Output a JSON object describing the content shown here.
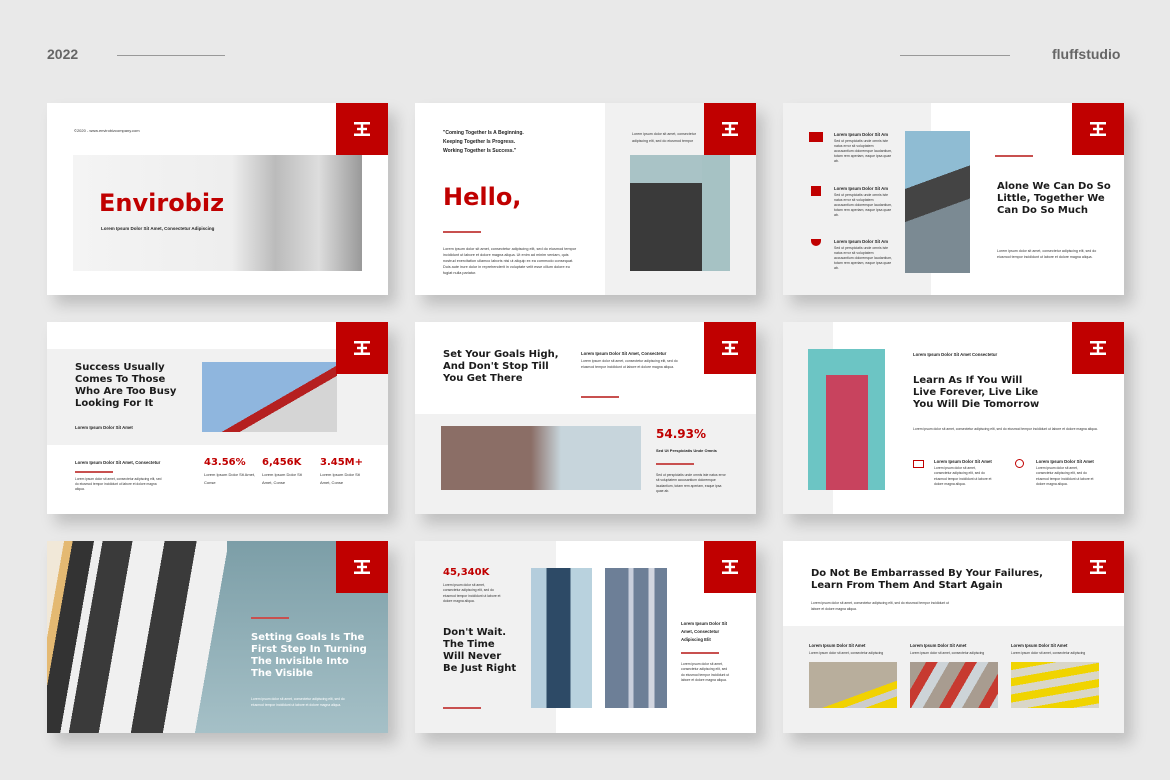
{
  "header": {
    "year": "2022",
    "brand": "fluffstudio"
  },
  "colors": {
    "accent": "#c00000",
    "panel": "#f1f1f1",
    "background": "#e9e9e9"
  },
  "logo_icon": "envirobiz-logo-icon",
  "lorem_short": "Lorem ipsum dolor sit amet, consectetur adipiscing elit, sed do eiusmod tempor incididunt ut labore et dolore magna aliqua.",
  "lorem_long": "Lorem ipsum dolor sit amet, consectetur adipiscing elit, sed do eiusmod tempor incididunt ut labore et dolore magna aliqua. Ut enim ad minim veniam, quis nostrud exercitation ullamco laboris nisi ut aliquip ex ea commodo consequat. Duis aute irure dolor in reprehenderit in voluptate velit esse cillum dolore eu fugiat nulla pariatur.",
  "lorem_sed": "Sed ut perspiciatis unde omnis iste natus error sit voluptatem accusantium doloremque laudantium, totam rem aperiam, eaque ipsa quae ab.",
  "slides": [
    {
      "copyright": "©2020 - www.envirobizcompany.com",
      "title": "Envirobiz",
      "subtitle": "Lorem Ipsum Dolor Sit Amet, Consectetur Adipiscing"
    },
    {
      "quote": [
        "\"Coming Together Is A Beginning.",
        "Keeping Together Is Progress.",
        "Working Together Is Success.\""
      ],
      "title": "Hello,",
      "side_text": "Lorem ipsum dolor sit amet, consectetur adipiscing elit, sed do eiusmod tempor"
    },
    {
      "items": [
        {
          "icon": "building-icon",
          "title": "Lorem Ipsum Dolor Sit Am"
        },
        {
          "icon": "calendar-icon",
          "title": "Lorem Ipsum Dolor Sit Am"
        },
        {
          "icon": "trophy-icon",
          "title": "Lorem Ipsum Dolor Sit Am"
        }
      ],
      "title": "Alone We Can Do So Little, Together We Can Do So Much"
    },
    {
      "title": "Success Usually Comes To Those Who Are Too Busy Looking For It",
      "subtitle": "Lorem Ipsum Dolor Sit Amet",
      "left_title": "Lorem Ipsum Dolor Sit Amet, Consectetur",
      "stats": [
        {
          "value": "43.56%",
          "label": "Lorem Ipsum Dolor Sit Amet, Conse"
        },
        {
          "value": "6,456K",
          "label": "Lorem Ipsum Dolor Sit Amet, Conse"
        },
        {
          "value": "3.45M+",
          "label": "Lorem Ipsum Dolor Sit Amet, Conse"
        }
      ]
    },
    {
      "title": "Set Your Goals High, And Don't Stop Till You Get There",
      "side_title": "Lorem Ipsum Dolor Sit Amet, Consectetur",
      "stat": "54.93%",
      "stat_label": "Sed Ut Perspiciatis Unde Omnis"
    },
    {
      "kicker": "Lorem Ipsum Dolor Sit Amet Consectetur",
      "title": "Learn As If You Will Live Forever, Live Like You Will Die Tomorrow",
      "items": [
        {
          "icon": "presentation-icon",
          "title": "Lorem Ipsum Dolor Sit Amet"
        },
        {
          "icon": "search-icon",
          "title": "Lorem Ipsum Dolor Sit Amet"
        }
      ]
    },
    {
      "title": "Setting Goals Is The First Step In Turning The Invisible Into The Visible"
    },
    {
      "stat": "45,340K",
      "title": "Don't Wait. The Time Will Never Be Just Right",
      "side_title": "Lorem Ipsum Dolor Sit Amet, Consectetur Adipiscing Elit"
    },
    {
      "title": "Do Not Be Embarrassed By Your Failures, Learn From Them And Start Again",
      "columns": [
        {
          "title": "Lorem Ipsum Dolor Sit Amet",
          "text": "Lorem ipsum dolor sit amet, consectetur adipiscing"
        },
        {
          "title": "Lorem Ipsum Dolor Sit Amet",
          "text": "Lorem ipsum dolor sit amet, consectetur adipiscing"
        },
        {
          "title": "Lorem Ipsum Dolor Sit Amet",
          "text": "Lorem ipsum dolor sit amet, consectetur adipiscing"
        }
      ]
    }
  ]
}
